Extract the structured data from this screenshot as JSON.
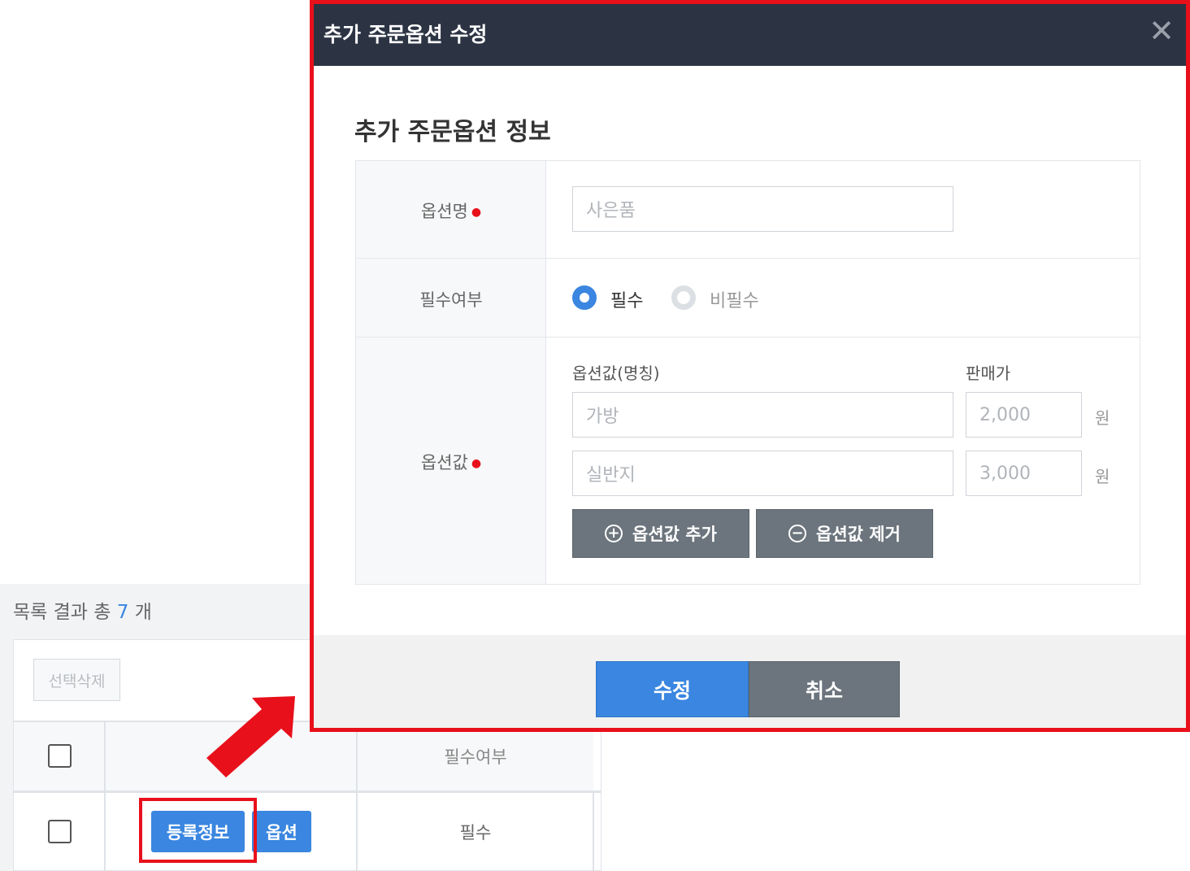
{
  "list": {
    "summary_prefix": "목록 결과 총",
    "summary_count": "7",
    "summary_suffix": "개",
    "delete_selected_label": "선택삭제",
    "column_required": "필수여부",
    "row": {
      "register_info_label": "등록정보",
      "option_label": "옵션",
      "required_value": "필수"
    }
  },
  "modal": {
    "title": "추가 주문옵션 수정",
    "close_glyph": "✕",
    "section_title": "추가 주문옵션 정보",
    "option_name_label": "옵션명",
    "option_name_value": "사은품",
    "required_label": "필수여부",
    "radio_required": "필수",
    "radio_optional": "비필수",
    "option_values_label": "옵션값",
    "col_option_value_name": "옵션값(명칭)",
    "col_price": "판매가",
    "option_values": [
      {
        "name": "가방",
        "price": "2,000",
        "unit": "원"
      },
      {
        "name": "실반지",
        "price": "3,000",
        "unit": "원"
      }
    ],
    "add_value_label": "옵션값 추가",
    "remove_value_label": "옵션값 제거",
    "submit_label": "수정",
    "cancel_label": "취소"
  },
  "colors": {
    "accent": "#3a86e0",
    "highlight": "#e8101b",
    "header_bg": "#2c3444",
    "gray_button": "#6c757d"
  }
}
